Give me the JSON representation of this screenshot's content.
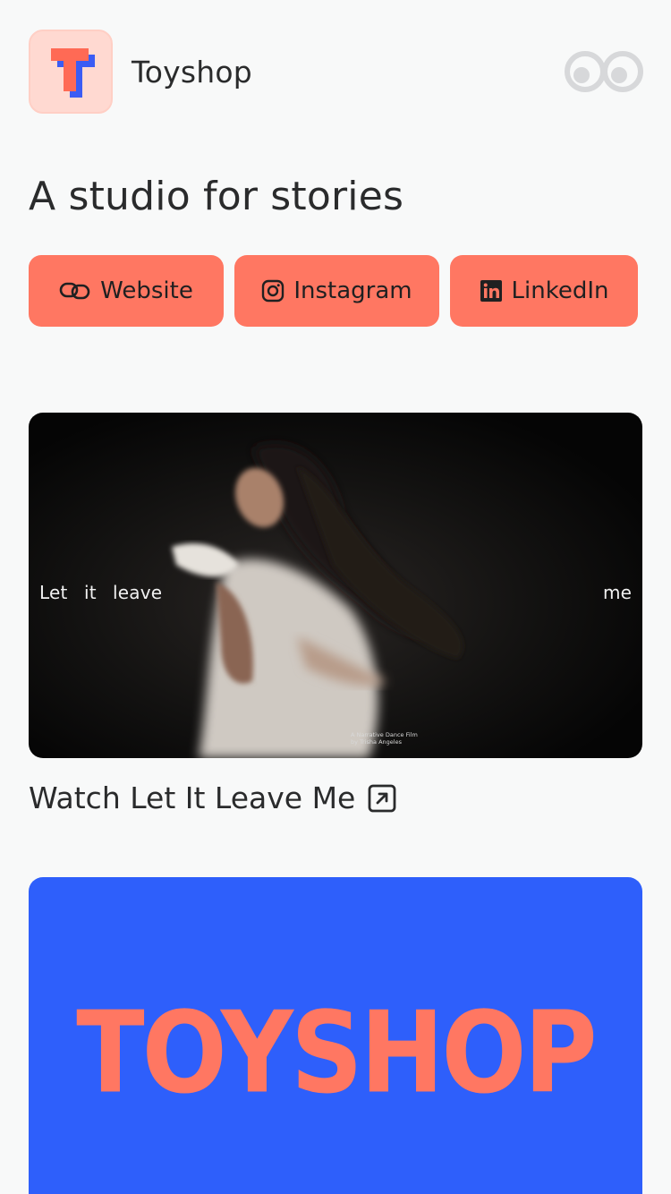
{
  "header": {
    "brand_name": "Toyshop",
    "logo_icon": "toyshop-t-logo-icon",
    "menu_icon": "linktree-infinity-icon"
  },
  "tagline": "A studio for stories",
  "links": [
    {
      "label": "Website",
      "icon": "link-icon"
    },
    {
      "label": "Instagram",
      "icon": "instagram-icon"
    },
    {
      "label": "LinkedIn",
      "icon": "linkedin-icon"
    }
  ],
  "video": {
    "overlay_words": [
      "Let",
      "it",
      "leave",
      "me"
    ],
    "credit_line1": "A Narrative Dance Film",
    "credit_line2": "by Trisha Angeles",
    "link_label": "Watch Let It Leave Me",
    "link_icon": "external-link-arrow-icon"
  },
  "brand_card": {
    "word": "TOYSHOP"
  },
  "colors": {
    "background": "#f8f9f9",
    "accent": "#ff7762",
    "logo_bg": "#ffd9d1",
    "brand_blue": "#2e5ffb",
    "text": "#2a2b2c"
  }
}
